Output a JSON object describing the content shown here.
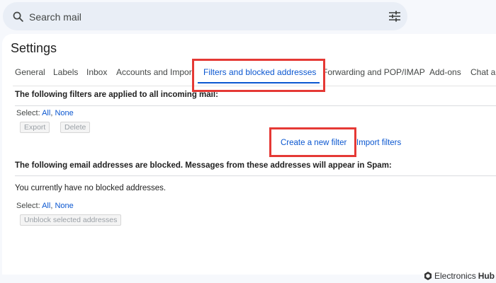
{
  "search": {
    "placeholder": "Search mail"
  },
  "settings": {
    "title": "Settings",
    "tabs": [
      {
        "label": "General"
      },
      {
        "label": "Labels"
      },
      {
        "label": "Inbox"
      },
      {
        "label": "Accounts and Impor"
      },
      {
        "label": "Filters and blocked addresses",
        "active": true
      },
      {
        "label": "Forwarding and POP/IMAP"
      },
      {
        "label": "Add-ons"
      },
      {
        "label": "Chat a"
      }
    ]
  },
  "filters": {
    "heading": "The following filters are applied to all incoming mail:",
    "select_label": "Select:",
    "select_all": "All",
    "select_sep": ",",
    "select_none": "None",
    "export_label": "Export",
    "delete_label": "Delete",
    "create_filter": "Create a new filter",
    "import_filters": "Import filters"
  },
  "blocked": {
    "heading": "The following email addresses are blocked. Messages from these addresses will appear in Spam:",
    "empty_message": "You currently have no blocked addresses.",
    "select_label": "Select:",
    "select_all": "All",
    "select_sep": ",",
    "select_none": "None",
    "unblock_label": "Unblock selected addresses"
  },
  "watermark": {
    "prefix": "Electronics",
    "brand": "Hub"
  },
  "colors": {
    "accent": "#0b57d0",
    "highlight": "#e53935",
    "background": "#f6f8fc"
  }
}
